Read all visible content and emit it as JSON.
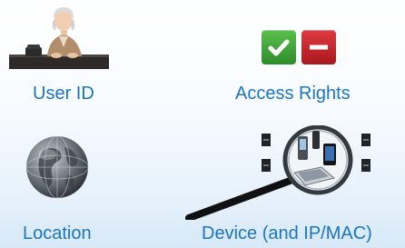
{
  "items": [
    {
      "label": "User ID",
      "icon": "person-at-desk-icon"
    },
    {
      "label": "Access Rights",
      "icon": "allow-deny-icon"
    },
    {
      "label": "Location",
      "icon": "globe-icon"
    },
    {
      "label": "Device (and IP/MAC)",
      "icon": "magnifier-devices-icon"
    }
  ],
  "colors": {
    "label": "#1a75c2",
    "allow": "#3fa535",
    "deny": "#c8232c",
    "background_top": "#ffffff",
    "background_bottom": "#d7e8f7"
  }
}
